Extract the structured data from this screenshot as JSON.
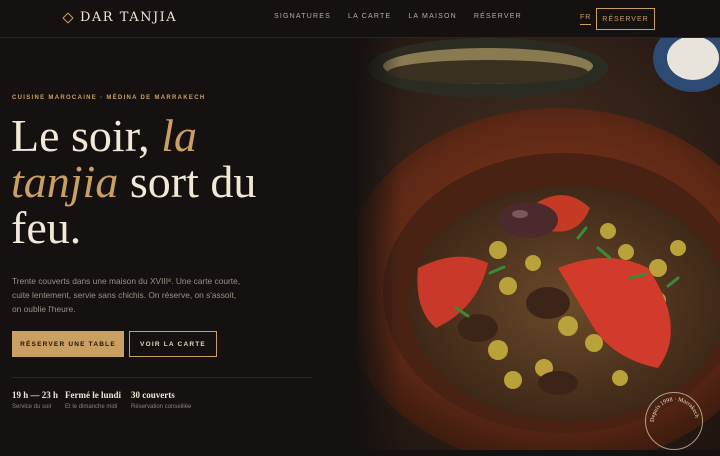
{
  "brand": {
    "name": "DAR TANJIA"
  },
  "nav": {
    "items": [
      "SIGNATURES",
      "LA CARTE",
      "LA MAISON",
      "RÉSERVER"
    ]
  },
  "header": {
    "lang": "FR",
    "reserve_label": "RÉSERVER"
  },
  "hero": {
    "eyebrow": "CUISINE MAROCAINE · MÉDINA DE MARRAKECH",
    "title_part1": "Le soir, ",
    "title_italic1": "la tanjia",
    "title_part2": " sort du feu.",
    "description": "Trente couverts dans une maison du XVIIIᵉ. Une carte courte, cuite lentement, servie sans chichis. On réserve, on s'assoit, on oublie l'heure.",
    "primary_cta": "RÉSERVER UNE TABLE",
    "secondary_cta": "VOIR LA CARTE"
  },
  "stats": [
    {
      "value": "19 h — 23 h",
      "label": "Service du soir"
    },
    {
      "value": "Fermé le lundi",
      "label": "Et le dimanche midi"
    },
    {
      "value": "30 couverts",
      "label": "Réservation conseillée"
    }
  ],
  "seal": {
    "text": "Depuis 1998 · Marrakech"
  },
  "colors": {
    "accent": "#c9a062",
    "background": "#141110",
    "text": "#f1e8d8"
  }
}
